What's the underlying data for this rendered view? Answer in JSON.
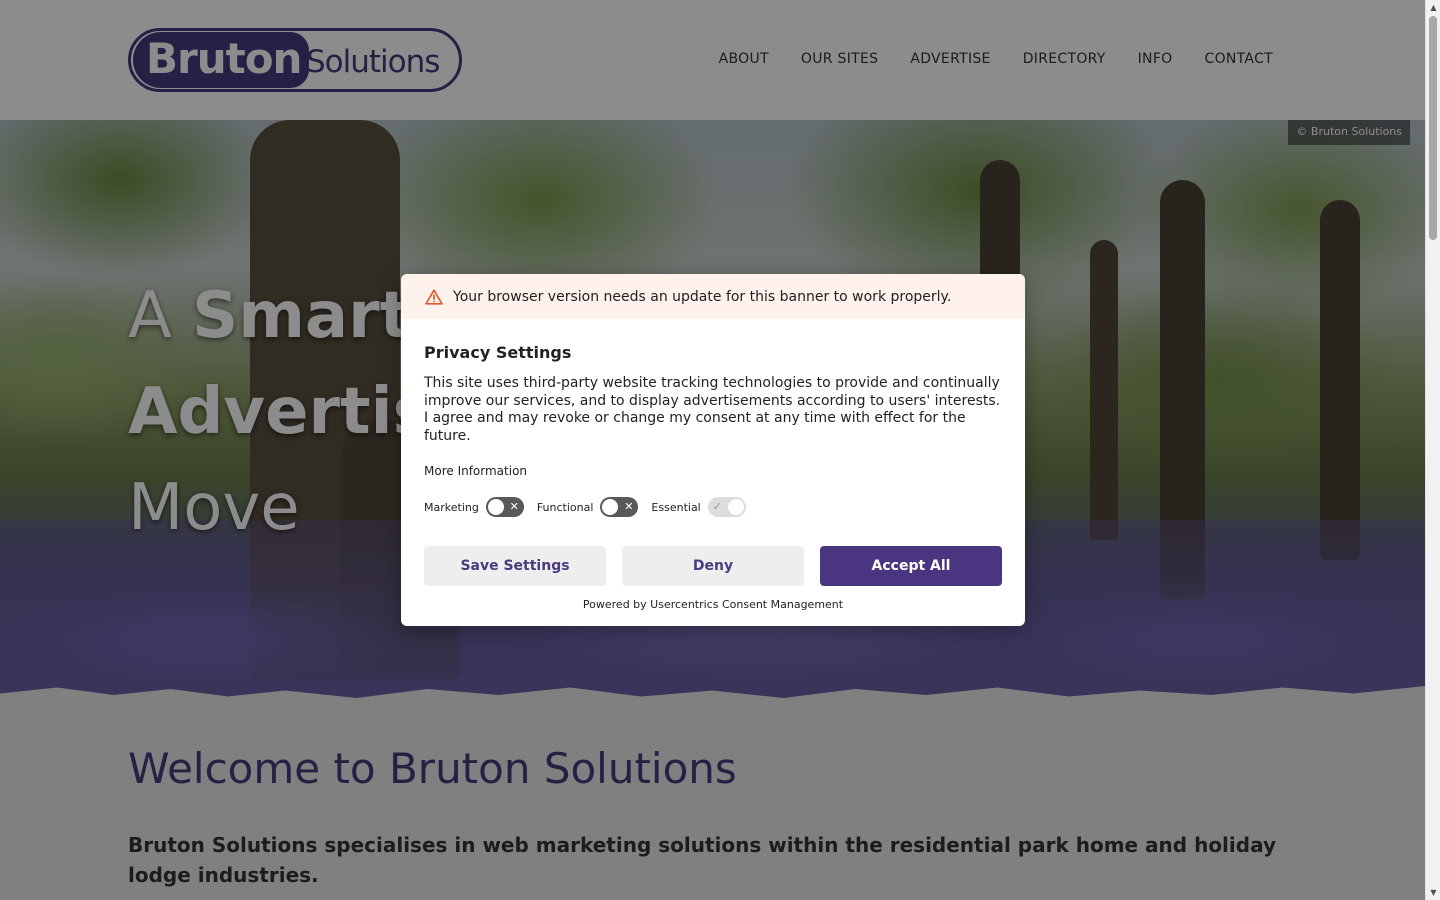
{
  "header": {
    "logo": {
      "word1": "Bruton",
      "word2": "Solutions",
      "brand_color": "#4a3a7e"
    },
    "nav": [
      {
        "label": "ABOUT"
      },
      {
        "label": "OUR SITES"
      },
      {
        "label": "ADVERTISE"
      },
      {
        "label": "DIRECTORY"
      },
      {
        "label": "INFO"
      },
      {
        "label": "CONTACT"
      }
    ]
  },
  "hero": {
    "line1_light": "A ",
    "line1_bold": "Smart",
    "line2_bold": "Advertis",
    "line3_light": "Move",
    "copyright": "©  Bruton Solutions"
  },
  "main": {
    "heading": "Welcome to Bruton Solutions",
    "intro": "Bruton Solutions specialises in web marketing solutions within the residential park home and holiday lodge industries."
  },
  "consent": {
    "warning": "Your browser version needs an update for this banner to work properly.",
    "title": "Privacy Settings",
    "text": "This site uses third-party website tracking technologies to provide and continually improve our services, and to display advertisements according to users' interests. I agree and may revoke or change my consent at any time with effect for the future.",
    "more_info": "More Information",
    "toggles": [
      {
        "label": "Marketing",
        "state": "off"
      },
      {
        "label": "Functional",
        "state": "off"
      },
      {
        "label": "Essential",
        "state": "on"
      }
    ],
    "buttons": {
      "save": "Save Settings",
      "deny": "Deny",
      "accept": "Accept All"
    },
    "powered_prefix": "Powered by ",
    "powered_link": "Usercentrics Consent Management",
    "accent_color": "#4a3580",
    "warning_bg": "#fff1ec"
  },
  "icons": {
    "warning": "warning-triangle-icon",
    "toggle_off": "x-mark-icon",
    "toggle_on": "check-mark-icon"
  }
}
